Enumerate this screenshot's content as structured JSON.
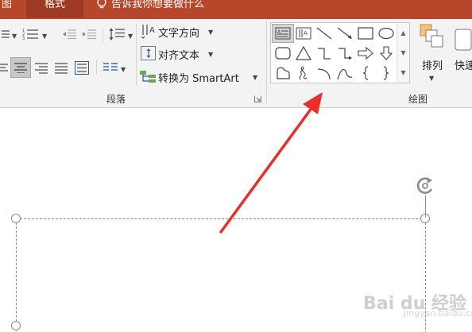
{
  "tabs": {
    "left_partial": "图",
    "active": "格式",
    "tell_me": "告诉我你想要做什么"
  },
  "paragraph_group": {
    "label": "段落",
    "text_direction": "文字方向",
    "align_text": "对齐文本",
    "convert_smartart": "转换为 SmartArt",
    "icons": [
      "bullets-icon",
      "numbering-icon",
      "decrease-indent-icon",
      "increase-indent-icon",
      "line-spacing-icon",
      "align-left-icon",
      "align-center-icon",
      "align-right-icon",
      "justify-icon",
      "distributed-icon",
      "columns-icon"
    ]
  },
  "drawing_group": {
    "label": "绘图",
    "arrange": "排列",
    "quick_styles": "快速",
    "shapes": [
      "text-box-icon",
      "vertical-text-box-icon",
      "line-icon",
      "arrow-line-icon",
      "rectangle-icon",
      "oval-icon",
      "rounded-rectangle-icon",
      "triangle-icon",
      "elbow-connector-icon",
      "elbow-arrow-connector-icon",
      "right-arrow-icon",
      "down-arrow-icon",
      "freeform-shape-icon",
      "scribble-icon",
      "arc-icon",
      "curve-icon",
      "left-brace-icon",
      "right-brace-icon"
    ]
  },
  "colors": {
    "tab_bar": "#b7472a",
    "active_tab": "#9f3a22",
    "ribbon": "#f3f3f3",
    "annotation_arrow": "#e8302a"
  },
  "watermark": {
    "main": "Bai du 经验",
    "sub": "jingyan.baidu.com"
  }
}
